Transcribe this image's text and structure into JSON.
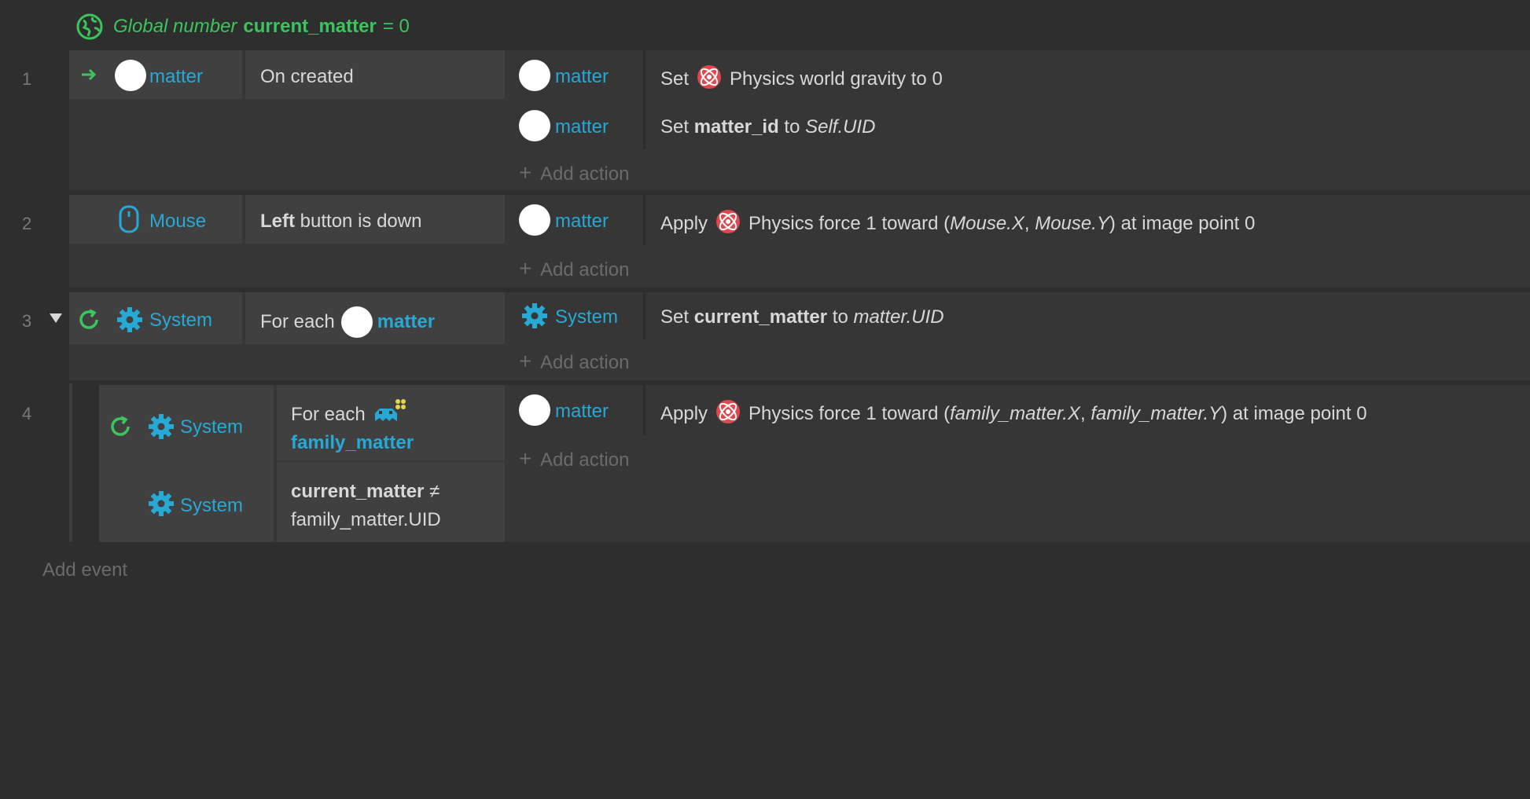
{
  "global_var": {
    "prefix": "Global number",
    "name": "current_matter",
    "equals": "= 0"
  },
  "events": [
    {
      "number": "1",
      "condition": {
        "object": "matter",
        "text": "On created"
      },
      "actions": [
        {
          "object": "matter",
          "verb": "Set",
          "rest": "Physics world gravity to 0"
        },
        {
          "object": "matter",
          "verb": "Set",
          "var": "matter_id",
          "to": "to",
          "expr": "Self.UID"
        }
      ]
    },
    {
      "number": "2",
      "condition": {
        "object": "Mouse",
        "bold": "Left",
        "text": "button is down"
      },
      "actions": [
        {
          "object": "matter",
          "verb": "Apply",
          "rest_before": "Physics force 1 toward (",
          "x": "Mouse.X",
          "sep": ", ",
          "y": "Mouse.Y",
          "rest_after": ") at image point 0"
        }
      ]
    },
    {
      "number": "3",
      "condition": {
        "object": "System",
        "text": "For each",
        "target": "matter"
      },
      "actions": [
        {
          "object": "System",
          "verb": "Set",
          "var": "current_matter",
          "to": "to",
          "expr": "matter.UID"
        }
      ]
    },
    {
      "number": "4",
      "conditions": [
        {
          "object": "System",
          "text": "For each",
          "target": "family_matter"
        },
        {
          "object": "System",
          "bold": "current_matter",
          "op": "≠",
          "text": "family_matter.UID"
        }
      ],
      "actions": [
        {
          "object": "matter",
          "verb": "Apply",
          "rest_before": "Physics force 1 toward (",
          "x": "family_matter.X",
          "sep": ", ",
          "y": "family_matter.Y",
          "rest_after": ") at image point 0"
        }
      ]
    }
  ],
  "add_action_label": "Add action",
  "add_event_label": "Add event",
  "icons": {
    "globe": "globe-icon",
    "trigger": "arrow-right-icon",
    "mouse": "mouse-icon",
    "loop": "loop-icon",
    "system": "gear-icon",
    "physics": "physics-icon",
    "family": "family-icon",
    "collapse": "triangle-down-icon"
  },
  "colors": {
    "background": "#2e2e2e",
    "event_row": "#363636",
    "condition_block": "#404040",
    "object_name": "#27a9d6",
    "global_var": "#3cc45e",
    "muted": "#6b6b6b"
  }
}
